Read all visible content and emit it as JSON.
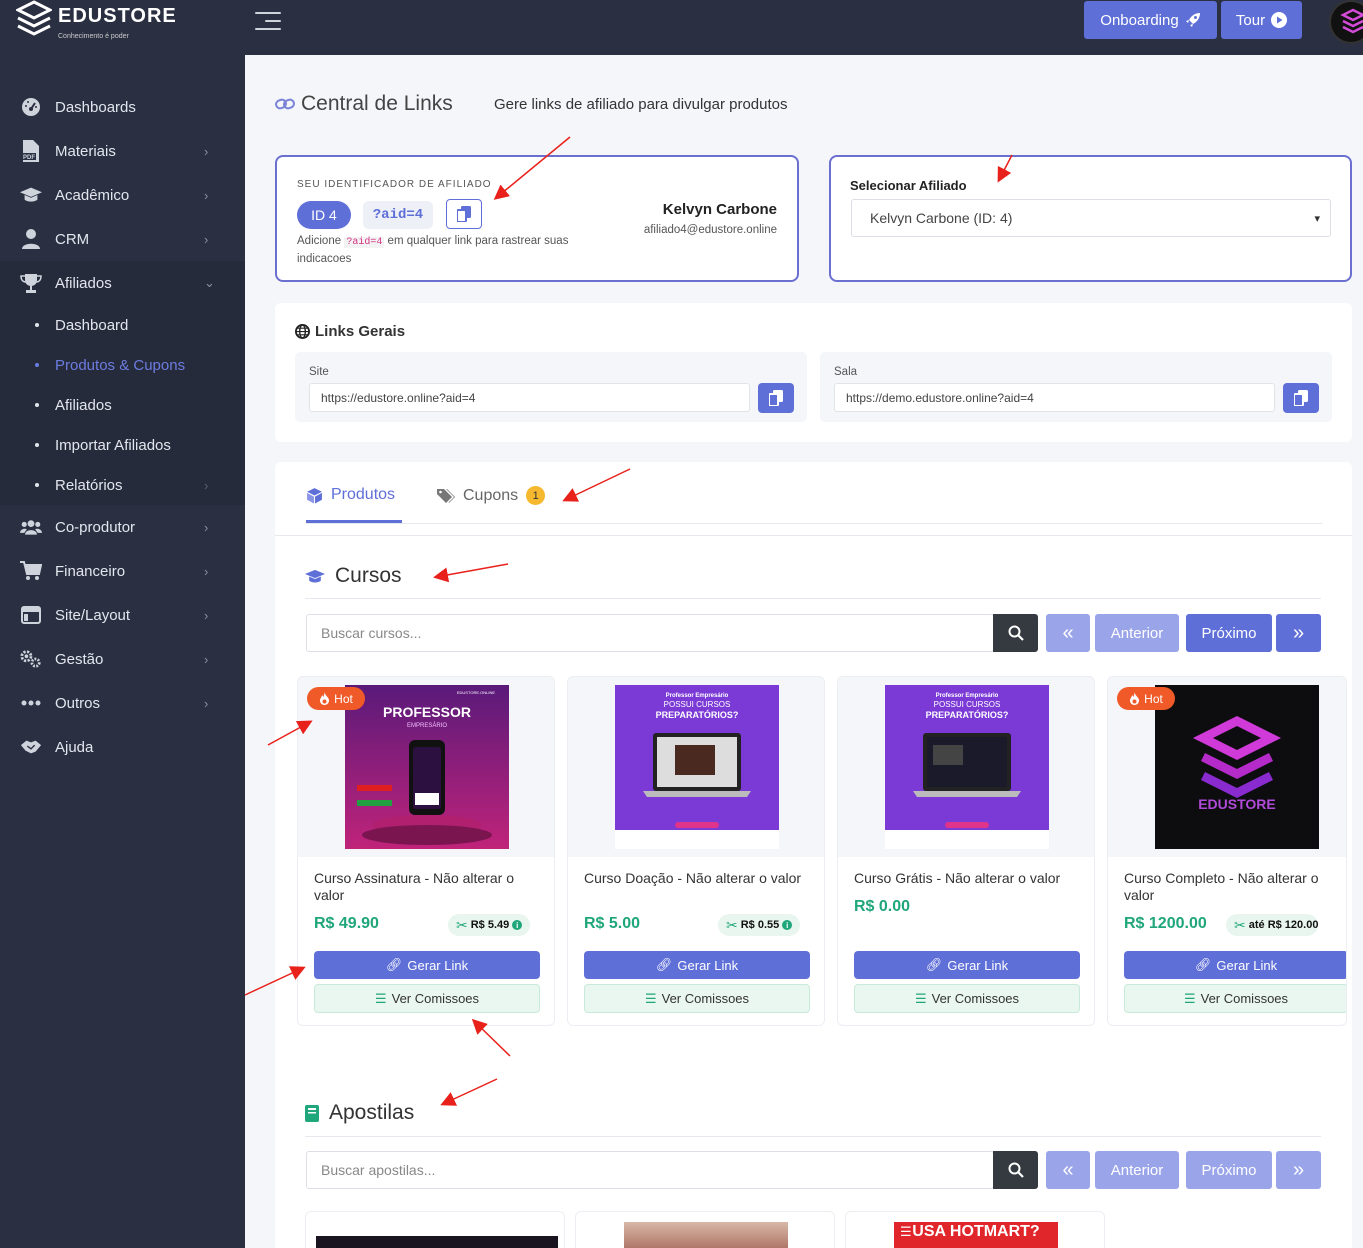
{
  "app": {
    "logo_text": "EDUSTORE",
    "logo_tagline": "Conhecimento é poder"
  },
  "topbar": {
    "onboarding_label": "Onboarding",
    "tour_label": "Tour"
  },
  "sidebar": {
    "items": [
      {
        "label": "Dashboards",
        "icon": "dashboard-icon"
      },
      {
        "label": "Materiais",
        "icon": "pdf-icon"
      },
      {
        "label": "Acadêmico",
        "icon": "graduation-cap-icon"
      },
      {
        "label": "CRM",
        "icon": "user-icon"
      },
      {
        "label": "Afiliados",
        "icon": "trophy-icon"
      }
    ],
    "sub_items": [
      {
        "label": "Dashboard"
      },
      {
        "label": "Produtos & Cupons",
        "active": true
      },
      {
        "label": "Afiliados"
      },
      {
        "label": "Importar Afiliados"
      },
      {
        "label": "Relatórios"
      }
    ],
    "items_after": [
      {
        "label": "Co-produtor",
        "icon": "users-icon"
      },
      {
        "label": "Financeiro",
        "icon": "cart-icon"
      },
      {
        "label": "Site/Layout",
        "icon": "layout-icon"
      },
      {
        "label": "Gestão",
        "icon": "gears-icon"
      },
      {
        "label": "Outros",
        "icon": "ellipsis-icon"
      },
      {
        "label": "Ajuda",
        "icon": "handshake-icon"
      }
    ]
  },
  "page": {
    "title": "Central de Links",
    "subtitle": "Gere links de afiliado para divulgar produtos"
  },
  "affiliate": {
    "label": "SEU IDENTIFICADOR DE AFILIADO",
    "id_pill": "ID 4",
    "aid_code": "?aid=4",
    "help_before": "Adicione",
    "help_code": "?aid=4",
    "help_after": "em qualquer link para rastrear suas indicacoes",
    "name": "Kelvyn Carbone",
    "email": "afiliado4@edustore.online"
  },
  "select_affiliate": {
    "label": "Selecionar Afiliado",
    "value": "Kelvyn Carbone (ID: 4)"
  },
  "general_links": {
    "title": "Links Gerais",
    "site_label": "Site",
    "site_url": "https://edustore.online?aid=4",
    "room_label": "Sala",
    "room_url": "https://demo.edustore.online?aid=4"
  },
  "tabs": {
    "products": "Produtos",
    "coupons": "Cupons",
    "coupons_count": "1"
  },
  "courses": {
    "title": "Cursos",
    "search_placeholder": "Buscar cursos...",
    "prev": "Anterior",
    "next": "Próximo",
    "first": "«",
    "last": "»",
    "items": [
      {
        "title": "Curso Assinatura - Não alterar o valor",
        "price": "R$ 49.90",
        "commission": "R$ 5.49",
        "hot": "Hot",
        "generate": "Gerar Link",
        "view": "Ver Comissoes"
      },
      {
        "title": "Curso Doação - Não alterar o valor",
        "price": "R$ 5.00",
        "commission": "R$ 0.55",
        "generate": "Gerar Link",
        "view": "Ver Comissoes"
      },
      {
        "title": "Curso Grátis - Não alterar o valor",
        "price": "R$ 0.00",
        "generate": "Gerar Link",
        "view": "Ver Comissoes"
      },
      {
        "title": "Curso Completo - Não alterar o valor",
        "price": "R$ 1200.00",
        "commission": "até R$ 120.00",
        "hot": "Hot",
        "generate": "Gerar Link",
        "view": "Ver Comissoes"
      }
    ],
    "thumb_texts": {
      "professor": "PROFESSOR",
      "empresario": "EMPRESÁRIO",
      "domain": "EDUSTORE.ONLINE",
      "promo_l1": "Professor Empresário",
      "promo_l2": "POSSUI CURSOS",
      "promo_l3": "PREPARATÓRIOS?"
    }
  },
  "apostilas": {
    "title": "Apostilas",
    "search_placeholder": "Buscar apostilas...",
    "prev": "Anterior",
    "next": "Próximo",
    "first": "«",
    "last": "»",
    "hotmart": "USA HOTMART?"
  },
  "colors": {
    "primary": "#5f6fd8",
    "sidebar": "#2a3042",
    "success": "#1fa67a",
    "hot": "#f05a28",
    "badge": "#f5b82e"
  }
}
